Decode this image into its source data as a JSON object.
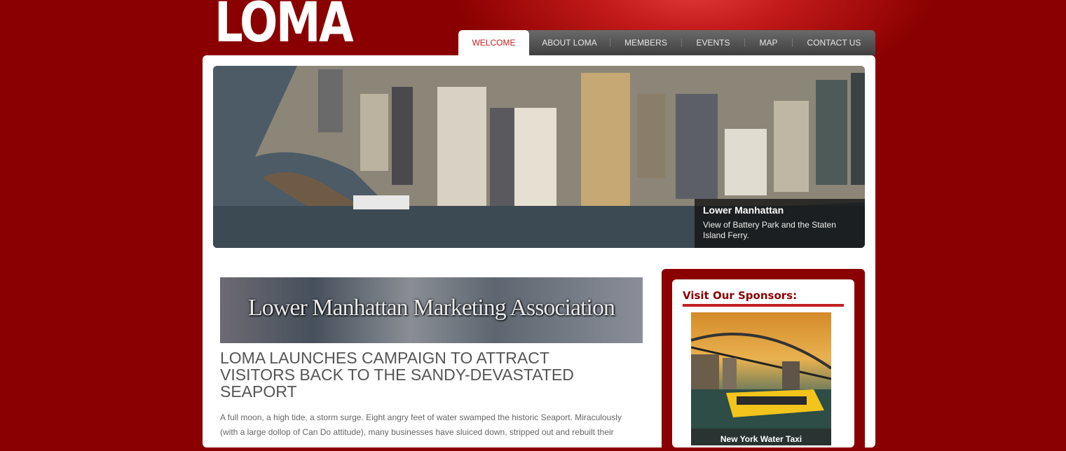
{
  "site": {
    "logo": "LOMA"
  },
  "nav": [
    {
      "label": "WELCOME",
      "active": true
    },
    {
      "label": "ABOUT LOMA"
    },
    {
      "label": "MEMBERS"
    },
    {
      "label": "EVENTS"
    },
    {
      "label": "MAP"
    },
    {
      "label": "CONTACT US"
    }
  ],
  "hero": {
    "title": "Lower Manhattan",
    "text": "View of Battery Park and the Staten Island Ferry."
  },
  "banner": {
    "text": "Lower Manhattan Marketing Association"
  },
  "article": {
    "headline": "LOMA LAUNCHES CAMPAIGN TO ATTRACT VISITORS BACK TO THE SANDY-DEVASTATED SEAPORT",
    "body": "A full moon, a high tide, a storm surge. Eight angry feet of water swamped the historic Seaport. Miraculously (with a large dollop of Can Do attitude), many businesses have sluiced down, stripped out and rebuilt their"
  },
  "sponsors": {
    "title": "Visit Our Sponsors:",
    "caption": "New York Water Taxi"
  },
  "colors": {
    "background": "#8a0000",
    "accent": "#c22020",
    "nav": "#4a4a4a"
  }
}
